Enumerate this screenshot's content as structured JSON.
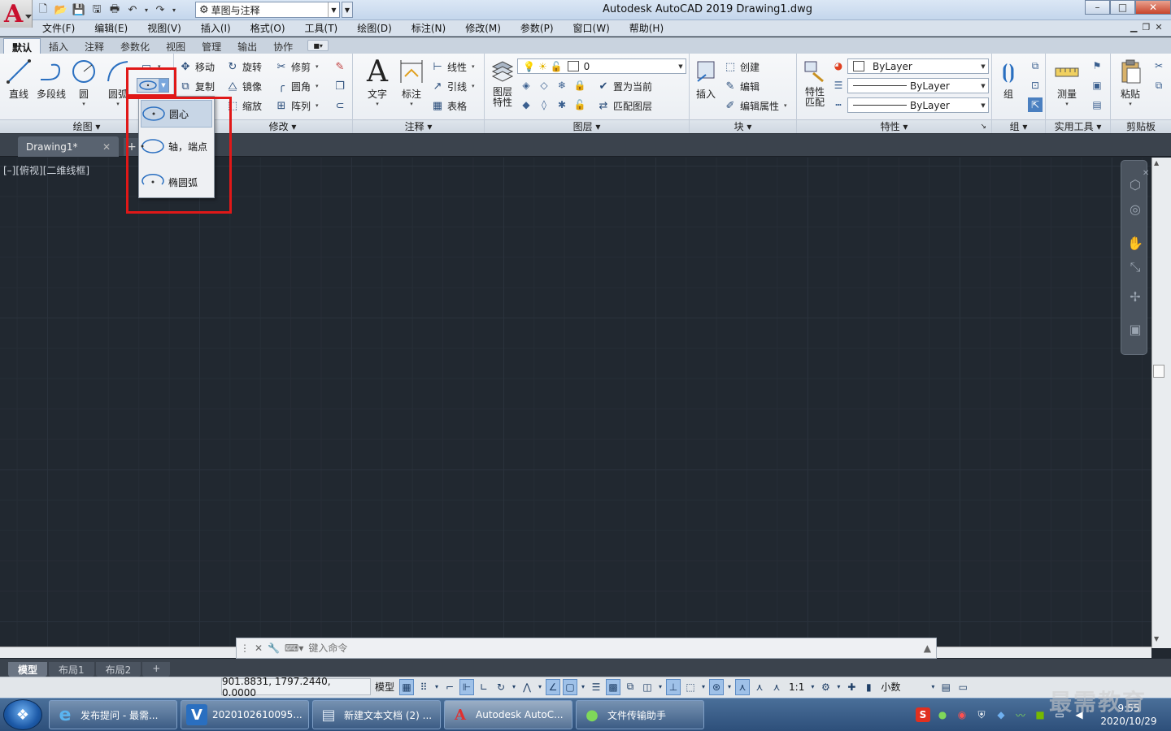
{
  "app": {
    "logo_letter": "A",
    "title": "Autodesk AutoCAD 2019    Drawing1.dwg"
  },
  "qat": {
    "workspace": "草图与注释"
  },
  "window_controls": {
    "minimize": "–",
    "maximize": "□",
    "close": "✕"
  },
  "menu": [
    "文件(F)",
    "编辑(E)",
    "视图(V)",
    "插入(I)",
    "格式(O)",
    "工具(T)",
    "绘图(D)",
    "标注(N)",
    "修改(M)",
    "参数(P)",
    "窗口(W)",
    "帮助(H)"
  ],
  "ribbon_tabs": [
    "默认",
    "插入",
    "注释",
    "参数化",
    "视图",
    "管理",
    "输出",
    "协作"
  ],
  "ribbon": {
    "draw": {
      "title": "绘图",
      "line": "直线",
      "polyline": "多段线",
      "circle": "圆",
      "arc": "圆弧"
    },
    "modify": {
      "title": "修改",
      "move": "移动",
      "rotate": "旋转",
      "trim": "修剪",
      "copy": "复制",
      "mirror": "镜像",
      "fillet": "圆角",
      "scale": "缩放",
      "array": "阵列"
    },
    "annotation": {
      "title": "注释",
      "text": "文字",
      "dimension": "标注",
      "linear": "线性",
      "leader": "引线",
      "table": "表格"
    },
    "layers": {
      "title": "图层",
      "layer_props": "图层\n特性",
      "current_layer": "0",
      "set_current": "置为当前",
      "match_layer": "匹配图层"
    },
    "block": {
      "title": "块",
      "insert": "插入",
      "create": "创建",
      "edit": "编辑",
      "edit_attr": "编辑属性"
    },
    "properties": {
      "title": "特性",
      "match": "特性\n匹配",
      "color": "ByLayer",
      "linetype": "ByLayer",
      "lineweight": "ByLayer"
    },
    "groups": {
      "title": "组",
      "group": "组"
    },
    "utilities": {
      "title": "实用工具",
      "measure": "测量"
    },
    "clipboard": {
      "title": "剪贴板",
      "paste": "粘贴"
    }
  },
  "ellipse_menu": {
    "items": [
      "圆心",
      "轴，端点",
      "椭圆弧"
    ]
  },
  "file_tabs": {
    "active": "Drawing1*",
    "close": "✕",
    "new": "+"
  },
  "viewport": {
    "label": "[–][俯视][二维线框]"
  },
  "command_line": {
    "placeholder": "键入命令"
  },
  "layout_tabs": [
    "模型",
    "布局1",
    "布局2"
  ],
  "status": {
    "coords": "901.8831, 1797.2440, 0.0000",
    "model": "模型",
    "scale": "1:1",
    "units": "小数"
  },
  "taskbar": {
    "items": [
      "发布提问 - 最需...",
      "2020102610095...",
      "新建文本文档 (2) ...",
      "Autodesk AutoC...",
      "文件传输助手"
    ],
    "time": "9:55",
    "date": "2020/10/29",
    "watermark": "最需教育"
  }
}
